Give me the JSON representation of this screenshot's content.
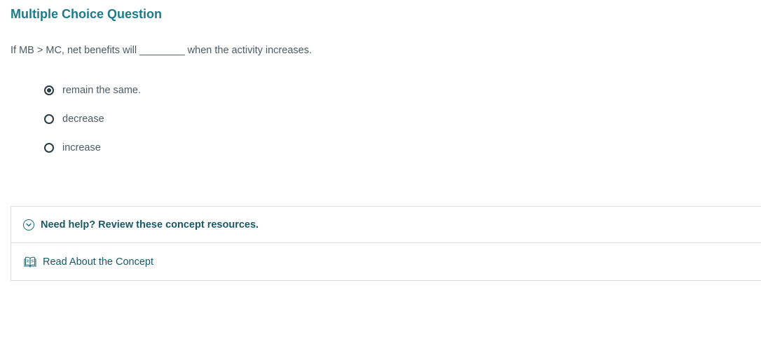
{
  "question": {
    "title": "Multiple Choice Question",
    "prompt": "If MB > MC, net benefits will ________ when the activity increases."
  },
  "options": [
    {
      "label": "remain the same.",
      "selected": true
    },
    {
      "label": "decrease",
      "selected": false
    },
    {
      "label": "increase",
      "selected": false
    }
  ],
  "help": {
    "header": "Need help? Review these concept resources.",
    "header_icon": "chevron-down-circle-icon",
    "link_label": "Read About the Concept",
    "link_icon": "book-icon"
  },
  "colors": {
    "title": "#1d7a88",
    "link": "#1b5866",
    "text": "#4c5a63",
    "border": "#d9dde0"
  }
}
